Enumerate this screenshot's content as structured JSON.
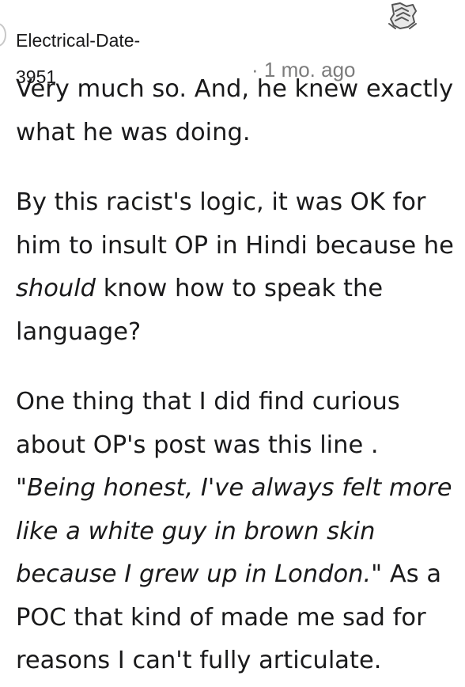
{
  "comment": {
    "author_line1": "Electrical-Date-",
    "author_line2": "3951",
    "timestamp": "· 1 mo. ago",
    "award_icon": "handshake-award-icon",
    "paragraphs": [
      {
        "text": "Very much so. And, he knew exactly what he was doing."
      },
      {
        "before": "By this racist's logic, it was OK for him to insult OP in Hindi because he ",
        "emphasis": "should",
        "after": " know how to speak the language?"
      },
      {
        "before": "One thing that I did find curious about OP's post was this line . ",
        "emphasis": "\"Being honest, I've always felt more like a white guy in brown skin because I grew up in London.\"",
        "after": " As a POC that kind of made me sad for reasons I can't fully articulate."
      }
    ]
  }
}
